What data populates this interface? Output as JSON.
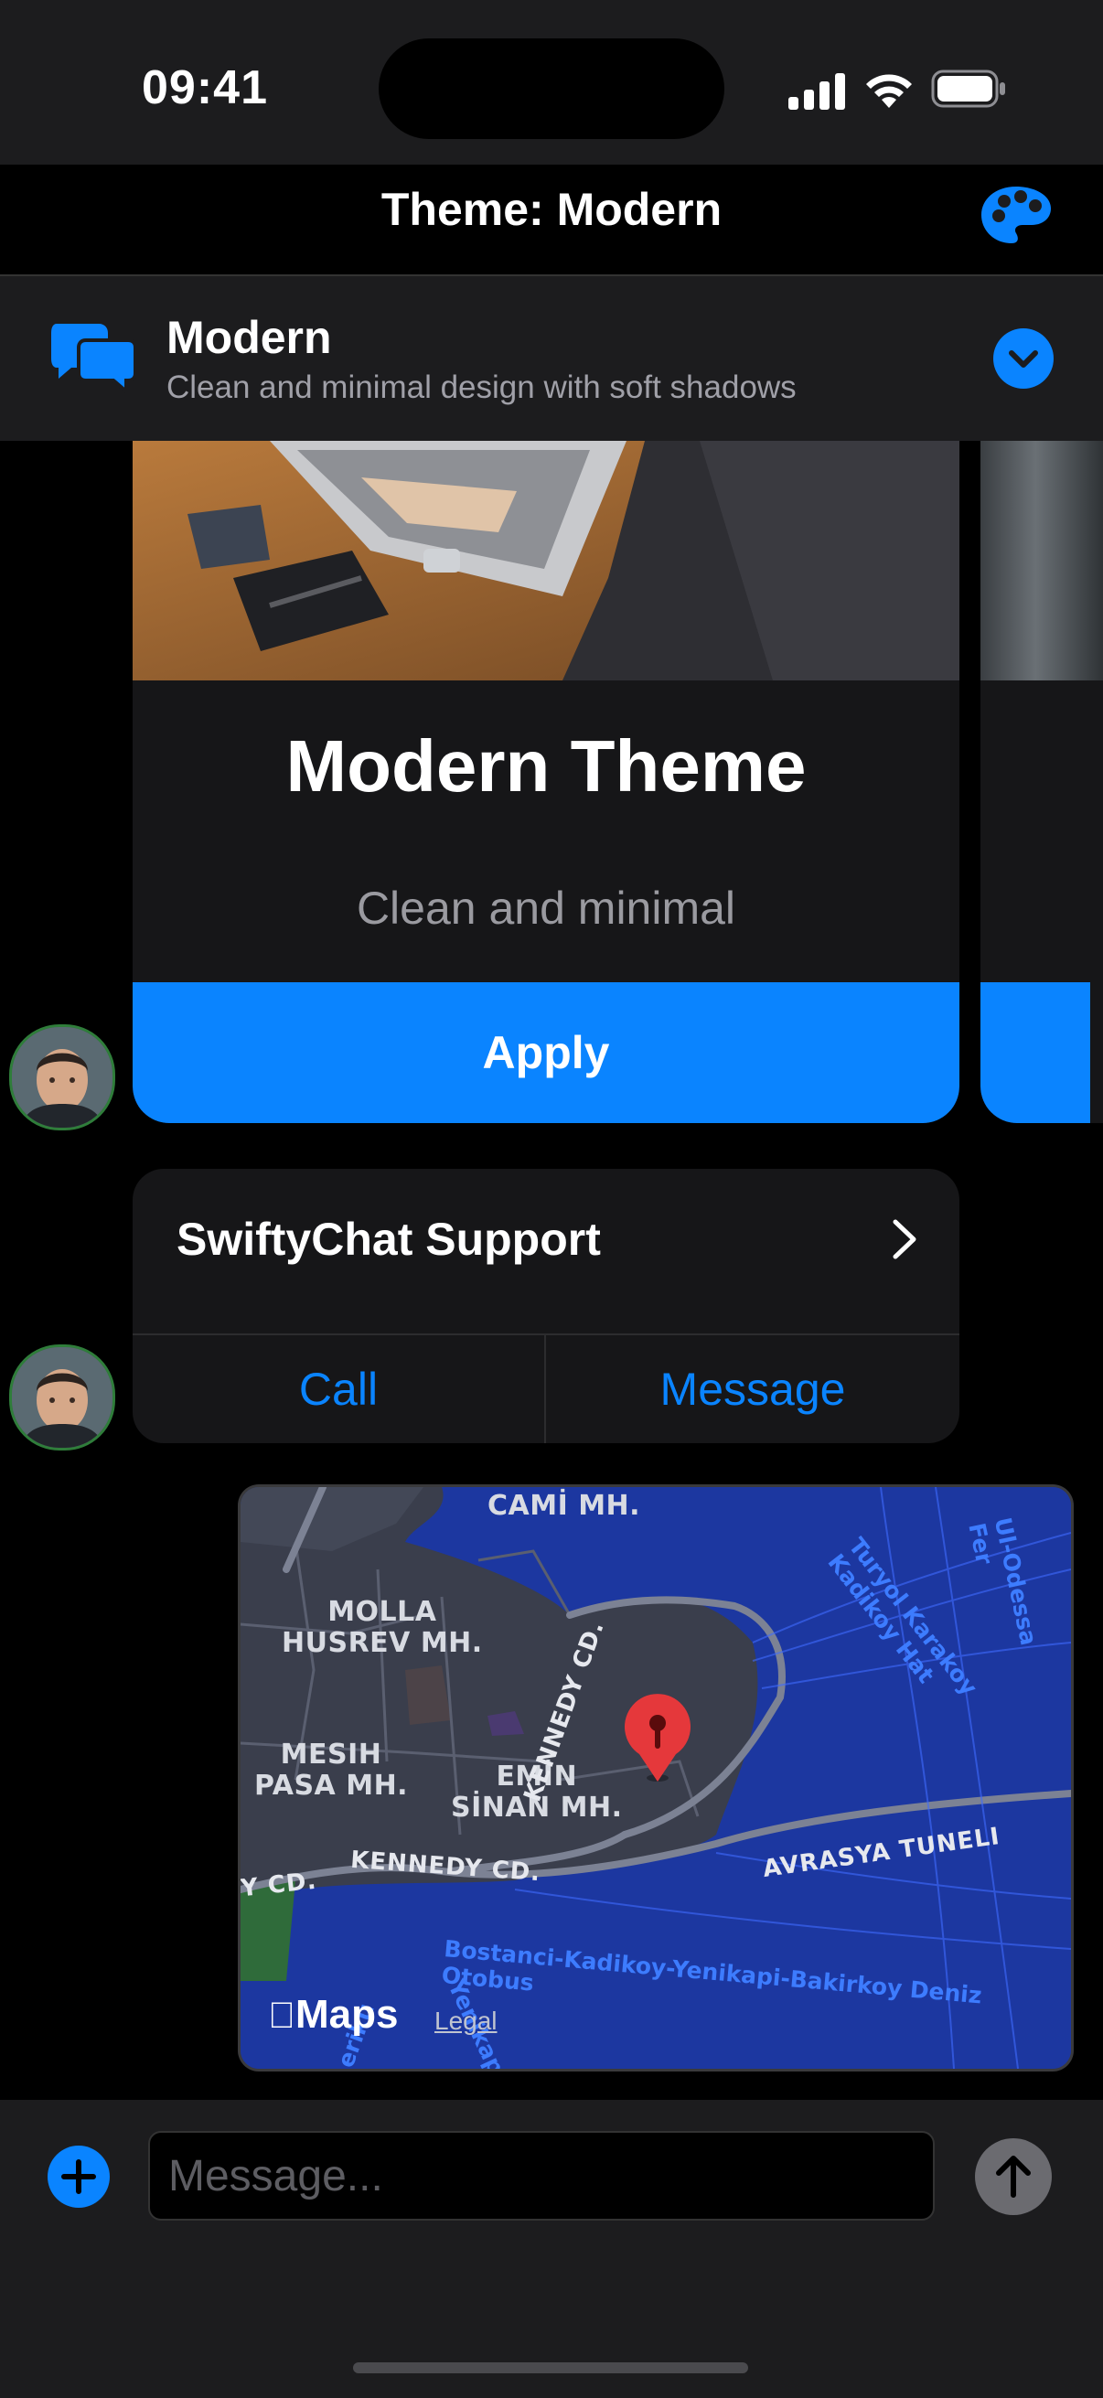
{
  "status_bar": {
    "time": "09:41"
  },
  "nav": {
    "title": "Theme: Modern"
  },
  "theme_selector": {
    "name": "Modern",
    "description": "Clean and minimal design with soft shadows"
  },
  "theme_card": {
    "title": "Modern Theme",
    "subtitle": "Clean and minimal",
    "button_label": "Apply"
  },
  "contact_card": {
    "name": "SwiftyChat Support",
    "call_label": "Call",
    "message_label": "Message"
  },
  "map": {
    "labels": {
      "cami": "CAMİ MH.",
      "molla_1": "MOLLA",
      "molla_2": "HUSREV MH.",
      "mesih_1": "MESIH",
      "mesih_2": "PASA MH.",
      "emin_1": "EMİN",
      "emin_2": "SİNAN MH.",
      "kennedy_1": "KENNEDY CD.",
      "kennedy_2": "KENNEDY CD.",
      "kennedy_left": "Y CD.",
      "avrasya": "AVRASYA TUNELI",
      "ferry_1": "Bostanci-Kadikoy-Yenikapi-Bakirkoy Deniz Otobus",
      "ferry_2": "Turyol Karakoy Kadikoy Hat",
      "ferry_3": "Ul-Odessa Fer",
      "ferry_4": "Yenikapi",
      "ferry_5": "eriku"
    },
    "brand": "Maps",
    "legal": "Legal"
  },
  "composer": {
    "placeholder": "Message..."
  },
  "colors": {
    "accent": "#0a84ff",
    "pin": "#e5383b"
  }
}
